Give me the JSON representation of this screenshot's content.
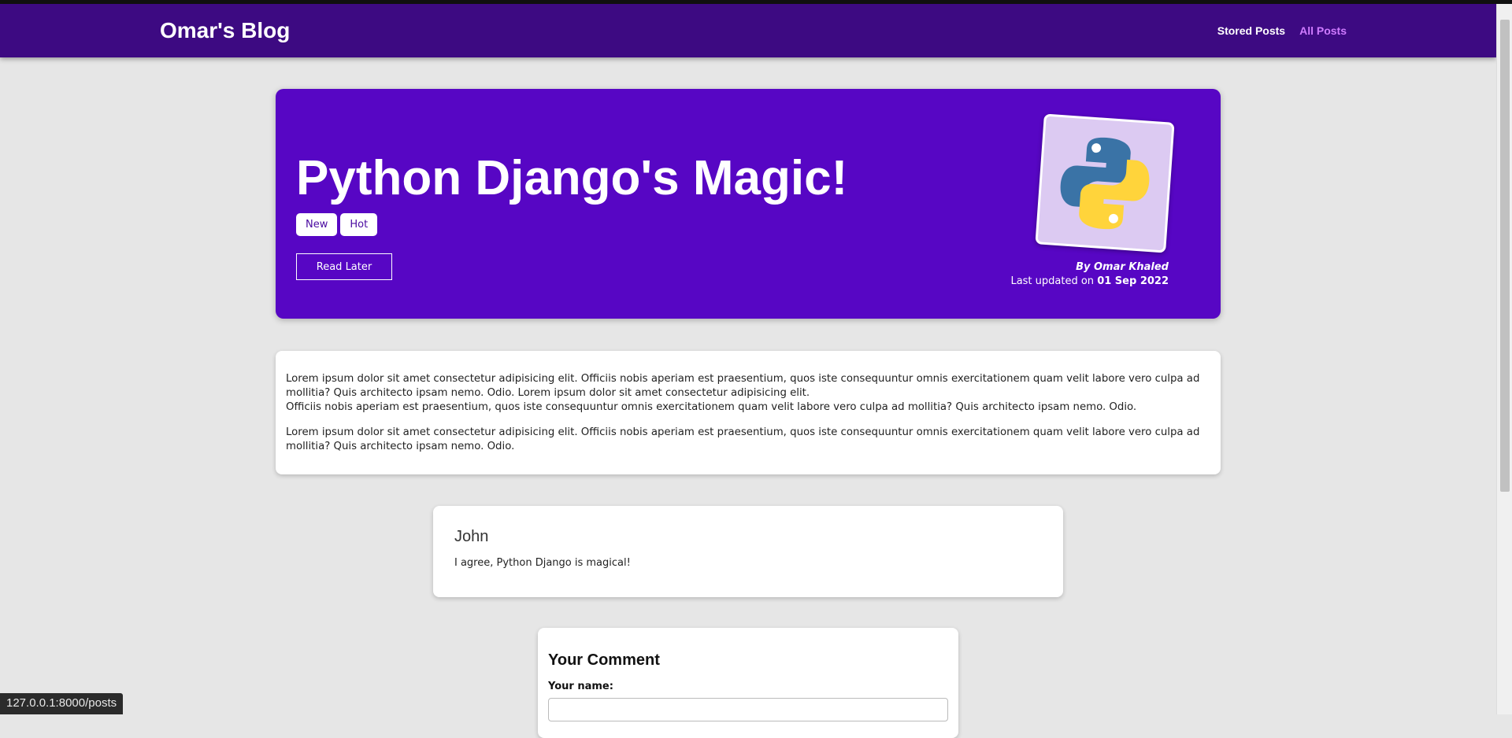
{
  "navbar": {
    "brand": "Omar's Blog",
    "links": [
      {
        "label": "Stored Posts",
        "active": false
      },
      {
        "label": "All Posts",
        "active": true
      }
    ]
  },
  "hero": {
    "title": "Python Django's Magic!",
    "tags": [
      "New",
      "Hot"
    ],
    "read_later_label": "Read Later",
    "image_icon": "python-logo-icon",
    "author": "By Omar Khaled",
    "updated_prefix": "Last updated on",
    "updated_date": "01 Sep 2022"
  },
  "content": {
    "paragraphs": [
      {
        "lines": [
          "Lorem ipsum dolor sit amet consectetur adipisicing elit. Officiis nobis aperiam est praesentium, quos iste consequuntur omnis exercitationem quam velit labore vero culpa ad mollitia? Quis architecto ipsam nemo. Odio. Lorem ipsum dolor sit amet consectetur adipisicing elit.",
          "Officiis nobis aperiam est praesentium, quos iste consequuntur omnis exercitationem quam velit labore vero culpa ad mollitia? Quis architecto ipsam nemo. Odio."
        ]
      },
      {
        "lines": [
          "Lorem ipsum dolor sit amet consectetur adipisicing elit. Officiis nobis aperiam est praesentium, quos iste consequuntur omnis exercitationem quam velit labore vero culpa ad mollitia? Quis architecto ipsam nemo. Odio."
        ]
      }
    ]
  },
  "comments": [
    {
      "author": "John",
      "text": "I agree, Python Django is magical!"
    }
  ],
  "comment_form": {
    "title": "Your Comment",
    "name_label": "Your name:",
    "name_value": ""
  },
  "status_bar": {
    "url": "127.0.0.1:8000/posts"
  },
  "colors": {
    "navbar": "#3d0a82",
    "hero": "#5706c4",
    "active_link": "#cf7bff",
    "background": "#e6e6e6"
  }
}
